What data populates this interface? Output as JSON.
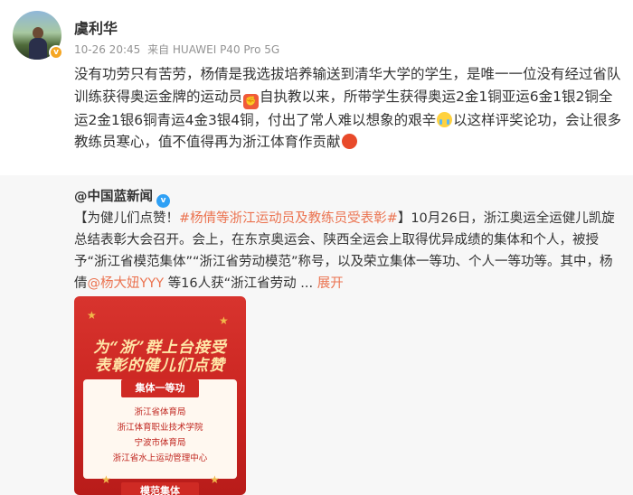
{
  "post": {
    "username": "虞利华",
    "timestamp": "10-26 20:45",
    "source": "来自 HUAWEI P40 Pro 5G",
    "verified_mark": "v",
    "text_part1": "没有功劳只有苦劳，杨倩是我选拔培养输送到清华大学的学生，是唯一一位没有经过省队训练获得奥运金牌的运动员",
    "emoji1": "fist-emoji",
    "text_part2": "自执教以来，所带学生获得奥运2金1铜亚运6金1银2铜全运2金1银6铜青运4金3银4铜，付出了常人难以想象的艰辛",
    "emoji2": "crying-emoji",
    "text_part3": "以这样评奖论功，会让很多教练员寒心，值不值得再为浙江体育作贡献",
    "emoji3": "angry-emoji"
  },
  "repost": {
    "author": "@中国蓝新闻",
    "verified_mark": "v",
    "bracket_title": "【为健儿们点赞！",
    "hashtag": "#杨倩等浙江运动员及教练员受表彰#",
    "bracket_close": "】",
    "text_part1": "10月26日，浙江奥运全运健儿凯旋总结表彰大会召开。会上，在东京奥运会、陕西全运会上取得优异成绩的集体和个人，被授予“浙江省模范集体”“浙江省劳动模范”称号，以及荣立集体一等功、个人一等功等。其中，杨倩",
    "mention": "@杨大妞YYY",
    "text_part2": "等16人获“浙江省劳动",
    "ellipsis": " ... ",
    "expand_label": "展开"
  },
  "poster": {
    "title_line1": "为“浙”群上台接受",
    "title_line2": "表彰的健儿们点赞",
    "section1": "集体一等功",
    "items": [
      "浙江省体育局",
      "浙江体育职业技术学院",
      "宁波市体育局",
      "浙江省水上运动管理中心"
    ],
    "section2": "模范集体"
  },
  "colors": {
    "link": "#eb7350",
    "meta_gray": "#939393",
    "repost_bg": "#f7f7f7",
    "poster_red": "#d8342e"
  }
}
